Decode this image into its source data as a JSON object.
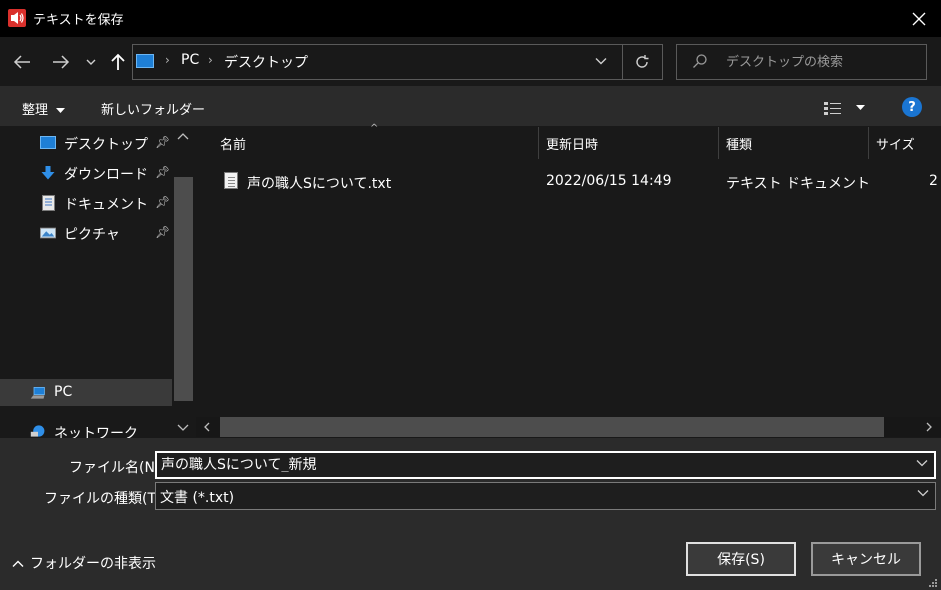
{
  "window": {
    "title": "テキストを保存"
  },
  "address": {
    "crumbs": [
      "PC",
      "デスクトップ"
    ],
    "search_placeholder": "デスクトップの検索"
  },
  "toolbar": {
    "organize_label": "整理",
    "new_folder_label": "新しいフォルダー"
  },
  "nav": {
    "quick_access": [
      {
        "label": "デスクトップ",
        "icon": "desktop-icon",
        "pinned": true
      },
      {
        "label": "ダウンロード",
        "icon": "download-icon",
        "pinned": true
      },
      {
        "label": "ドキュメント",
        "icon": "document-icon",
        "pinned": true
      },
      {
        "label": "ピクチャ",
        "icon": "picture-icon",
        "pinned": true
      }
    ],
    "pc_label": "PC",
    "network_label": "ネットワーク"
  },
  "filelist": {
    "columns": [
      "名前",
      "更新日時",
      "種類",
      "サイズ"
    ],
    "rows": [
      {
        "name": "声の職人Sについて.txt",
        "modified": "2022/06/15 14:49",
        "type": "テキスト ドキュメント",
        "size": "2"
      }
    ]
  },
  "form": {
    "filename_label": "ファイル名(N):",
    "filename_value": "声の職人Sについて_新規",
    "filetype_label": "ファイルの種類(T):",
    "filetype_value": "文書 (*.txt)"
  },
  "footer": {
    "hide_folders_label": "フォルダーの非表示",
    "save_label": "保存(S)",
    "cancel_label": "キャンセル"
  },
  "colors": {
    "accent": "#1a75d2",
    "background": "#191919",
    "panel": "#2b2b2b",
    "app_icon": "#d9302c"
  }
}
